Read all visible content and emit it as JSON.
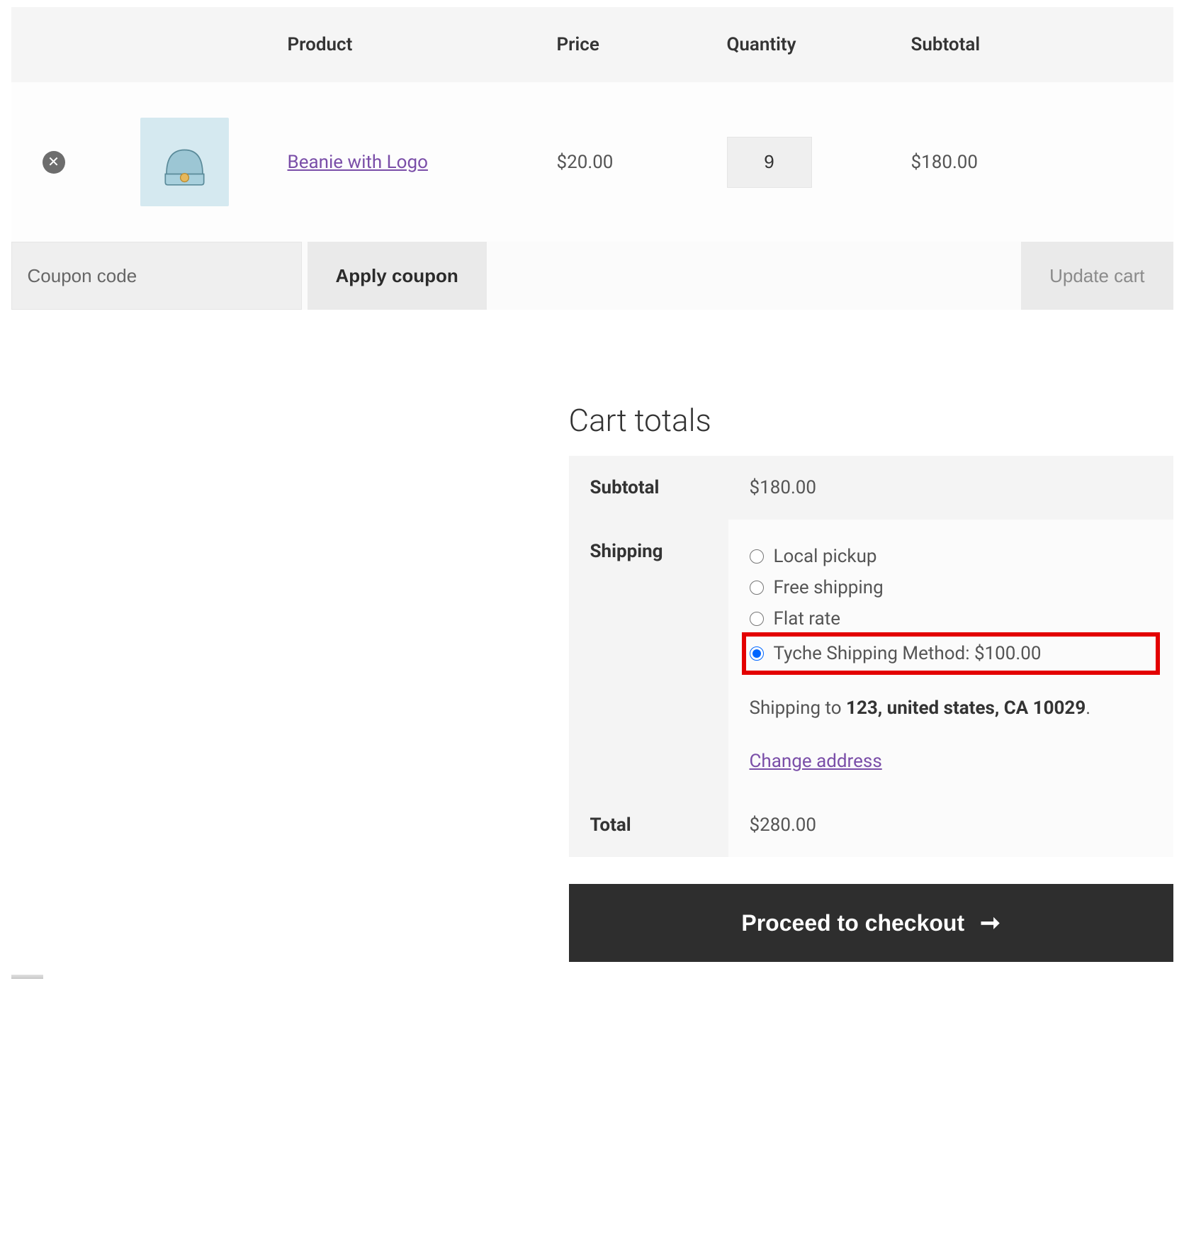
{
  "headers": {
    "product": "Product",
    "price": "Price",
    "quantity": "Quantity",
    "subtotal": "Subtotal"
  },
  "item": {
    "name": "Beanie with Logo",
    "price": "$20.00",
    "qty": "9",
    "subtotal": "$180.00"
  },
  "coupon": {
    "placeholder": "Coupon code",
    "apply": "Apply coupon"
  },
  "update_cart": "Update cart",
  "totals": {
    "title": "Cart totals",
    "subtotal_label": "Subtotal",
    "subtotal_value": "$180.00",
    "shipping_label": "Shipping",
    "options": {
      "local": "Local pickup",
      "free": "Free shipping",
      "flat": "Flat rate",
      "tyche": "Tyche Shipping Method: $100.00"
    },
    "shipping_to_prefix": "Shipping to ",
    "shipping_to_bold": "123, united states, CA 10029",
    "shipping_to_suffix": ".",
    "change_address": "Change address",
    "total_label": "Total",
    "total_value": "$280.00"
  },
  "checkout": "Proceed to checkout"
}
